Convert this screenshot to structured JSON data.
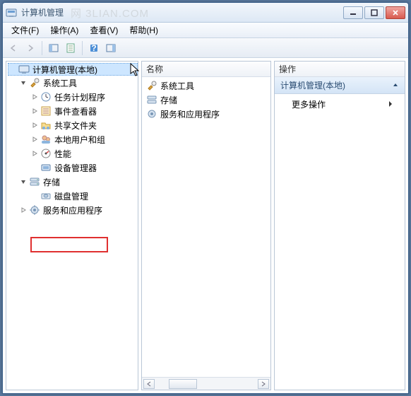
{
  "window": {
    "title": "计算机管理",
    "watermark": "网 3LIAN.COM"
  },
  "menu": {
    "file": "文件(F)",
    "action": "操作(A)",
    "view": "查看(V)",
    "help": "帮助(H)"
  },
  "tree": {
    "root": "计算机管理(本地)",
    "system_tools": "系统工具",
    "task_scheduler": "任务计划程序",
    "event_viewer": "事件查看器",
    "shared_folders": "共享文件夹",
    "local_users": "本地用户和组",
    "performance": "性能",
    "device_manager": "设备管理器",
    "storage": "存储",
    "disk_management": "磁盘管理",
    "services_apps": "服务和应用程序"
  },
  "list": {
    "header_name": "名称",
    "items": {
      "system_tools": "系统工具",
      "storage": "存储",
      "services_apps": "服务和应用程序"
    }
  },
  "actions": {
    "header": "操作",
    "section_title": "计算机管理(本地)",
    "more": "更多操作"
  }
}
